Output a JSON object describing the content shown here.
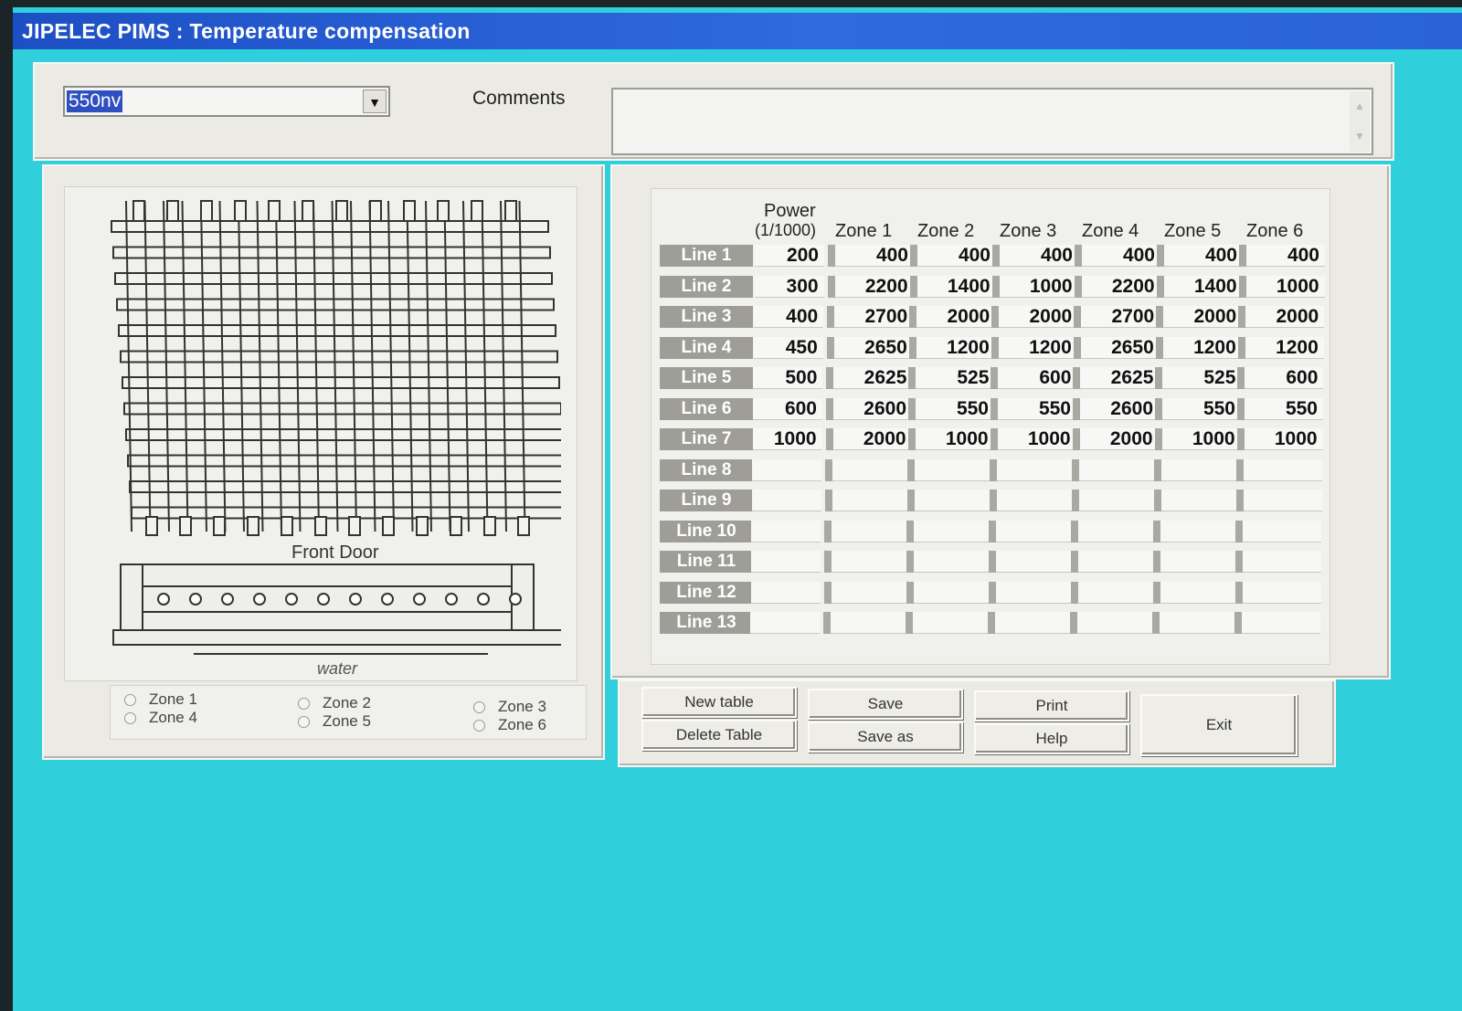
{
  "window": {
    "title": "JIPELEC  PIMS : Temperature compensation"
  },
  "selector": {
    "value": "550nv",
    "arrow": "▼"
  },
  "comments": {
    "label": "Comments",
    "value": ""
  },
  "diagram": {
    "front_door_label": "Front Door",
    "water_label": "water"
  },
  "zones": [
    {
      "label": "Zone 1"
    },
    {
      "label": "Zone 2"
    },
    {
      "label": "Zone 3"
    },
    {
      "label": "Zone 4"
    },
    {
      "label": "Zone 5"
    },
    {
      "label": "Zone 6"
    }
  ],
  "table": {
    "header_power_1": "Power",
    "header_power_2": "(1/1000)",
    "zone_headers": [
      "Zone 1",
      "Zone 2",
      "Zone 3",
      "Zone 4",
      "Zone 5",
      "Zone 6"
    ],
    "rows": [
      {
        "label": "Line 1",
        "values": [
          "200",
          "400",
          "400",
          "400",
          "400",
          "400",
          "400"
        ]
      },
      {
        "label": "Line 2",
        "values": [
          "300",
          "2200",
          "1400",
          "1000",
          "2200",
          "1400",
          "1000"
        ]
      },
      {
        "label": "Line 3",
        "values": [
          "400",
          "2700",
          "2000",
          "2000",
          "2700",
          "2000",
          "2000"
        ]
      },
      {
        "label": "Line 4",
        "values": [
          "450",
          "2650",
          "1200",
          "1200",
          "2650",
          "1200",
          "1200"
        ]
      },
      {
        "label": "Line 5",
        "values": [
          "500",
          "2625",
          "525",
          "600",
          "2625",
          "525",
          "600"
        ]
      },
      {
        "label": "Line 6",
        "values": [
          "600",
          "2600",
          "550",
          "550",
          "2600",
          "550",
          "550"
        ]
      },
      {
        "label": "Line 7",
        "values": [
          "1000",
          "2000",
          "1000",
          "1000",
          "2000",
          "1000",
          "1000"
        ]
      },
      {
        "label": "Line 8",
        "values": [
          "",
          "",
          "",
          "",
          "",
          "",
          ""
        ]
      },
      {
        "label": "Line 9",
        "values": [
          "",
          "",
          "",
          "",
          "",
          "",
          ""
        ]
      },
      {
        "label": "Line 10",
        "values": [
          "",
          "",
          "",
          "",
          "",
          "",
          ""
        ]
      },
      {
        "label": "Line 11",
        "values": [
          "",
          "",
          "",
          "",
          "",
          "",
          ""
        ]
      },
      {
        "label": "Line 12",
        "values": [
          "",
          "",
          "",
          "",
          "",
          "",
          ""
        ]
      },
      {
        "label": "Line 13",
        "values": [
          "",
          "",
          "",
          "",
          "",
          "",
          ""
        ]
      }
    ]
  },
  "buttons": {
    "new_table": "New table",
    "delete_table": "Delete Table",
    "save": "Save",
    "save_as": "Save as",
    "print": "Print",
    "help": "Help",
    "exit": "Exit"
  },
  "colors": {
    "desktop": "#2fd0db",
    "titlebar": "#2a63d8",
    "panel": "#ebeae4"
  }
}
